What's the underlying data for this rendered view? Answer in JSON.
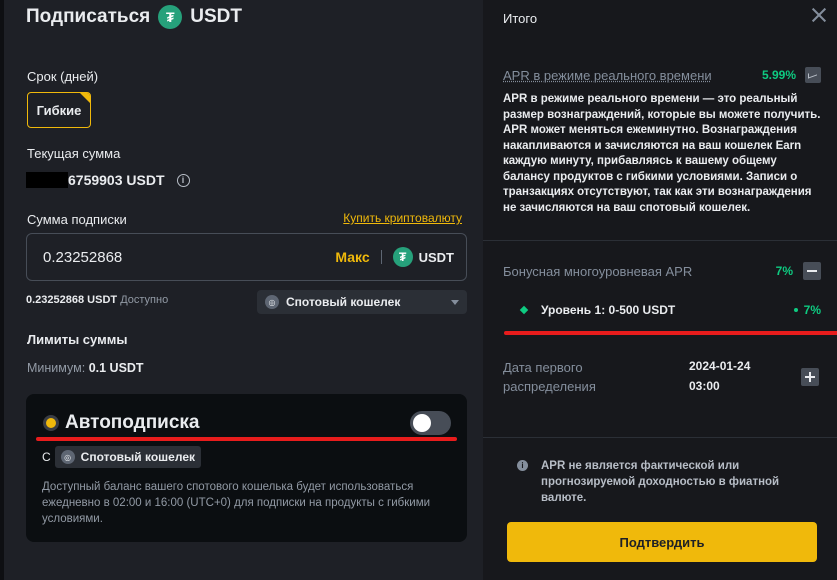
{
  "header": {
    "title": "Подписаться",
    "asset": "USDT",
    "icon": "tether-icon"
  },
  "term": {
    "label": "Срок (дней)",
    "option": "Гибкие"
  },
  "current_amount": {
    "label": "Текущая сумма",
    "value": "6759903 USDT"
  },
  "subscribe": {
    "label": "Сумма подписки",
    "buy_link": "Купить криптовалюту",
    "value": "0.23252868",
    "max_label": "Макс",
    "currency": "USDT",
    "available_amount": "0.23252868 USDT",
    "available_label": "Доступно",
    "wallet": "Спотовый кошелек"
  },
  "limits": {
    "label": "Лимиты суммы",
    "min_label": "Минимум:",
    "min_value": "0.1 USDT"
  },
  "auto_subscribe": {
    "title": "Автоподписка",
    "enabled": false,
    "from_label": "С",
    "wallet": "Спотовый кошелек",
    "description": "Доступный баланс вашего спотового кошелька будет использоваться ежедневно в 02:00 и 16:00 (UTC+0) для подписки на продукты с гибкими условиями."
  },
  "summary": {
    "title": "Итого",
    "apr_label": "APR в режиме реального времени",
    "apr_value": "5.99%",
    "apr_description": "APR в режиме реального времени — это реальный размер вознаграждений, которые вы можете получить. APR может меняться ежеминутно. Вознаграждения накапливаются и зачисляются на ваш кошелек Earn каждую минуту, прибавляясь к вашему общему балансу продуктов с гибкими условиями. Записи о транзакциях отсутствуют, так как эти вознаграждения не зачисляются на ваш спотовый кошелек.",
    "bonus_label": "Бонусная многоуровневая APR",
    "bonus_value": "7%",
    "tier_label": "Уровень 1: 0-500 USDT",
    "tier_value": "7%",
    "first_dist_label": "Дата первого распределения",
    "first_dist_date": "2024-01-24",
    "first_dist_time": "03:00",
    "disclaimer": "APR не является фактической или прогнозируемой доходностью в фиатной валюте.",
    "confirm_label": "Подтвердить"
  },
  "colors": {
    "accent": "#f0b90b",
    "positive": "#0ecb81",
    "annotation": "#e81c1c"
  }
}
